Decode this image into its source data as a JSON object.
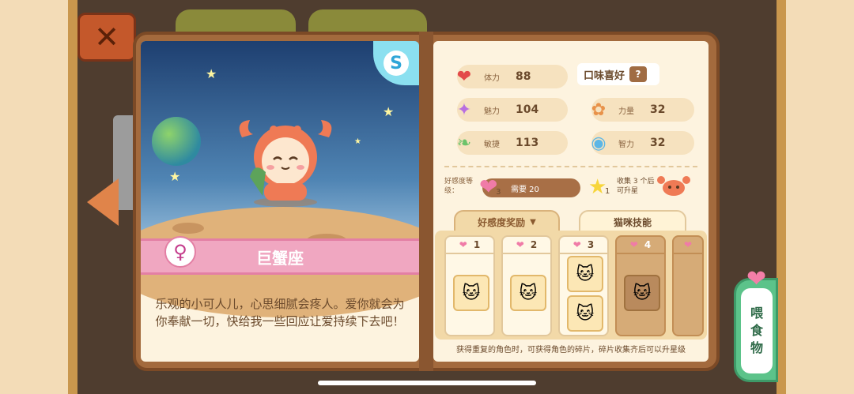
{
  "character": {
    "name": "巨蟹座",
    "sign_symbol": "♀",
    "rarity": "S",
    "description": "乐观的小可人儿，心思细腻会疼人。爱你就会为你奉献一切，快给我一些回应让爱持续下去吧！"
  },
  "stats": {
    "stamina": {
      "label": "体力",
      "value": "88",
      "icon": "heart-icon"
    },
    "charm": {
      "label": "魅力",
      "value": "104",
      "icon": "sparkle-icon"
    },
    "agility": {
      "label": "敏捷",
      "value": "113",
      "icon": "wing-icon"
    },
    "strength": {
      "label": "力量",
      "value": "32",
      "icon": "paw-icon"
    },
    "intelligence": {
      "label": "智力",
      "value": "32",
      "icon": "bulb-icon"
    }
  },
  "taste": {
    "label": "口味喜好",
    "unknown": "?"
  },
  "affection": {
    "label": "好感度等级：",
    "level": "3",
    "need": "需要 20",
    "star_level": "1",
    "collect_text": "收集 3 个后可升星"
  },
  "tabs": {
    "rewards": "好感度奖励",
    "skills": "猫咪技能"
  },
  "rewards": [
    {
      "level": "1",
      "locked": false
    },
    {
      "level": "2",
      "locked": false
    },
    {
      "level": "3",
      "locked": false
    },
    {
      "level": "4",
      "locked": true
    }
  ],
  "footer_note": "获得重复的角色时，可获得角色的碎片，碎片收集齐后可以升星级",
  "feed_button": {
    "chars": [
      "喂",
      "食",
      "物"
    ]
  },
  "close_label": "✕",
  "colors": {
    "accent": "#f07ba7",
    "book": "#a36a3d",
    "feed": "#5cc38a"
  }
}
